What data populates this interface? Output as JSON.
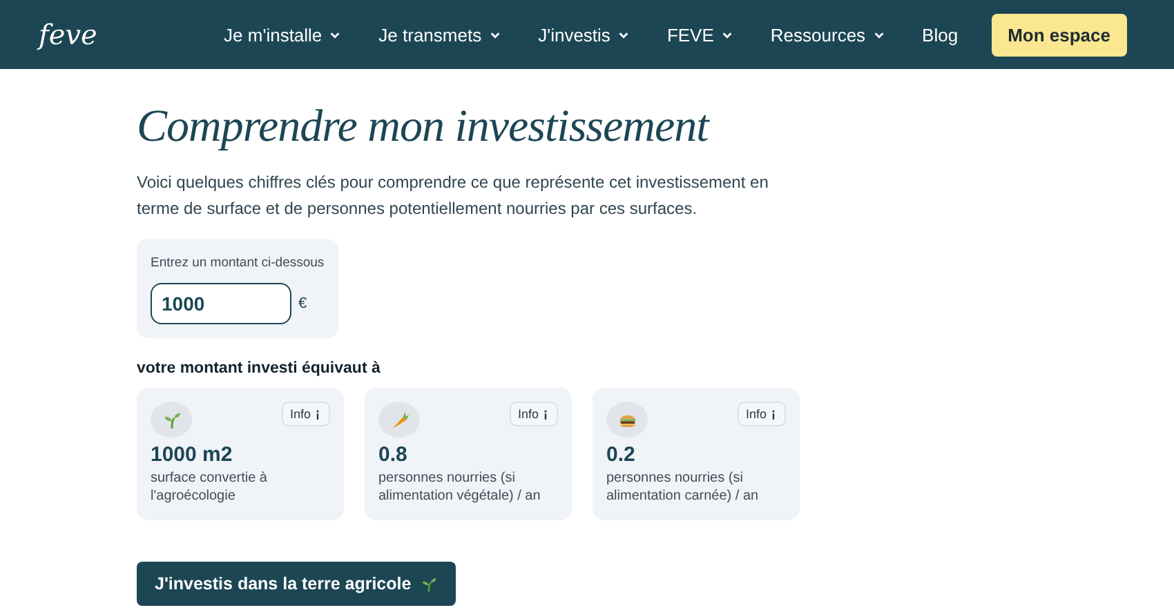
{
  "nav": {
    "logo": "feve",
    "items": [
      {
        "label": "Je m'installe",
        "dropdown": true
      },
      {
        "label": "Je transmets",
        "dropdown": true
      },
      {
        "label": "J'investis",
        "dropdown": true
      },
      {
        "label": "FEVE",
        "dropdown": true
      },
      {
        "label": "Ressources",
        "dropdown": true
      },
      {
        "label": "Blog",
        "dropdown": false
      }
    ],
    "cta": "Mon espace"
  },
  "title": "Comprendre mon investissement",
  "intro": "Voici quelques chiffres clés pour comprendre ce que représente cet investissement en terme de surface et de personnes potentiellement nourries par ces surfaces.",
  "amount": {
    "label": "Entrez un montant ci-dessous",
    "value": "1000",
    "currency": "€"
  },
  "result_label": "votre montant investi équivaut à",
  "cards": [
    {
      "kind": "sprout",
      "value": "1000 m2",
      "caption": "surface convertie à l'agroécologie",
      "info": "Info"
    },
    {
      "kind": "carrot",
      "value": "0.8",
      "caption": "personnes nourries (si alimentation végétale) / an",
      "info": "Info"
    },
    {
      "kind": "burger",
      "value": "0.2",
      "caption": "personnes nourries (si alimentation carnée) / an",
      "info": "Info"
    }
  ],
  "action": {
    "label": "J'investis dans la terre agricole"
  }
}
